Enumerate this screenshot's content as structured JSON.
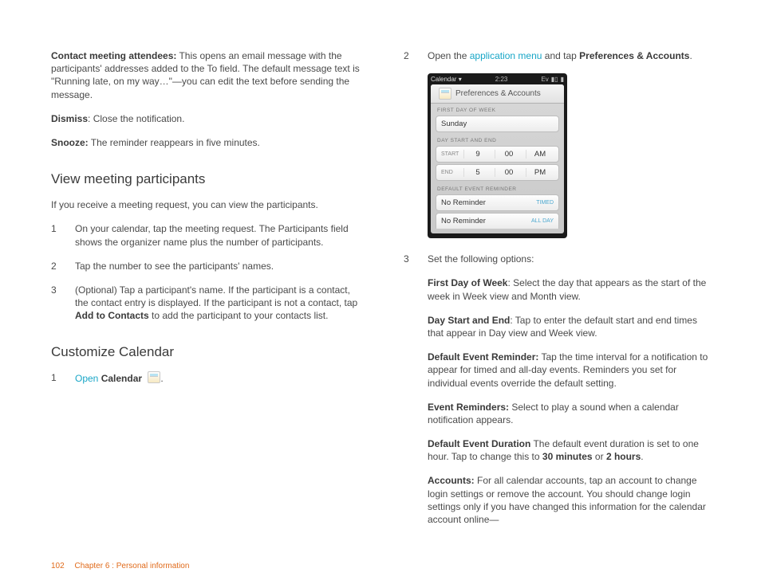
{
  "col1": {
    "contact_attendees_bold": "Contact meeting attendees:",
    "contact_attendees_text": " This opens an email message with the participants' addresses added to the To field. The default message text is \"Running late, on my way…\"—you can edit the text before sending the message.",
    "dismiss_bold": "Dismiss",
    "dismiss_text": ": Close the notification.",
    "snooze_bold": "Snooze:",
    "snooze_text": " The reminder reappears in five minutes.",
    "h_view": "View meeting participants",
    "view_intro": "If you receive a meeting request, you can view the participants.",
    "vp1": "On your calendar, tap the meeting request. The Participants field shows the organizer name plus the number of participants.",
    "vp2": "Tap the number to see the participants' names.",
    "vp3a": "(Optional) Tap a participant's name. If the participant is a contact, the contact entry is displayed. If the participant is not a contact, tap ",
    "vp3b": "Add to Contacts",
    "vp3c": " to add the participant to your contacts list.",
    "h_custom": "Customize Calendar",
    "cc_open": "Open",
    "cc_cal": " Calendar "
  },
  "col2": {
    "s2a": "Open the ",
    "s2b": "application menu",
    "s2c": " and tap ",
    "s2d": "Preferences & Accounts",
    "s2e": ".",
    "s3": "Set the following options:",
    "opt_fdw_b": "First Day of Week",
    "opt_fdw_t": ": Select the day that appears as the start of the week in Week view and Month view.",
    "opt_dse_b": "Day Start and End",
    "opt_dse_t": ": Tap to enter the default start and end times that appear in Day view and Week view.",
    "opt_der_b": "Default Event Reminder:",
    "opt_der_t": " Tap the time interval for a notification to appear for timed and all-day events. Reminders you set for individual events override the default setting.",
    "opt_er_b": "Event Reminders:",
    "opt_er_t": " Select to play a sound when a calendar notification appears.",
    "opt_ded_b": "Default Event Duration",
    "opt_ded_t1": " The default event duration is set to one hour. Tap to change this to ",
    "opt_ded_30": "30 minutes",
    "opt_ded_or": " or ",
    "opt_ded_2h": "2 hours",
    "opt_ded_dot": ".",
    "opt_acc_b": "Accounts:",
    "opt_acc_t": " For all calendar accounts, tap an account to change login settings or remove the account. You should change login settings only if you have changed this information for the calendar account online—"
  },
  "phone": {
    "menu": "Calendar ▾",
    "time": "2:23",
    "ev": "Ev",
    "title": "Preferences & Accounts",
    "lbl_fdw": "FIRST DAY OF WEEK",
    "sunday": "Sunday",
    "lbl_dse": "DAY START AND END",
    "start": "START",
    "end": "END",
    "s_h": "9",
    "s_m": "00",
    "s_ap": "AM",
    "e_h": "5",
    "e_m": "00",
    "e_ap": "PM",
    "lbl_der": "DEFAULT EVENT REMINDER",
    "no_rem": "No Reminder",
    "timed": "TIMED",
    "allday": "ALL DAY"
  },
  "footer": {
    "page": "102",
    "chapter": "Chapter 6 : Personal information"
  },
  "nums": {
    "n1": "1",
    "n2": "2",
    "n3": "3"
  }
}
